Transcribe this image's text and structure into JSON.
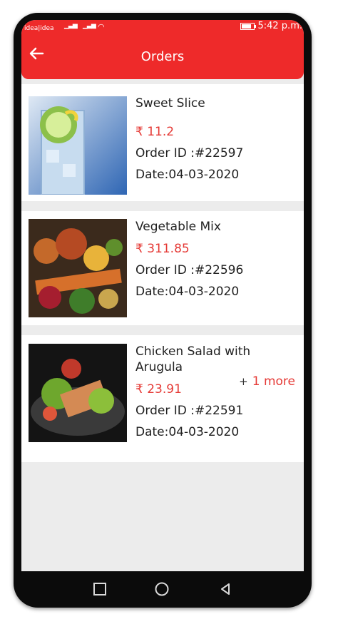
{
  "status": {
    "carrier": "idea|idea",
    "time": "5:42 p.m."
  },
  "header": {
    "title": "Orders",
    "back_icon": "arrow-left-icon"
  },
  "orders": [
    {
      "name": "Sweet Slice",
      "price": "₹ 11.2",
      "order_id": "Order ID :#22597",
      "date": "Date:04-03-2020",
      "more": ""
    },
    {
      "name": "Vegetable Mix",
      "price": "₹ 311.85",
      "order_id": "Order ID :#22596",
      "date": "Date:04-03-2020",
      "more": ""
    },
    {
      "name": "Chicken Salad with Arugula",
      "price": "₹ 23.91",
      "order_id": "Order ID :#22591",
      "date": "Date:04-03-2020",
      "more_plus": "+",
      "more": "1 more"
    }
  ],
  "colors": {
    "accent": "#ee2a2a",
    "price": "#e53935",
    "background": "#ececec"
  },
  "nav": {
    "icons": [
      "square-icon",
      "circle-icon",
      "triangle-back-icon"
    ]
  }
}
